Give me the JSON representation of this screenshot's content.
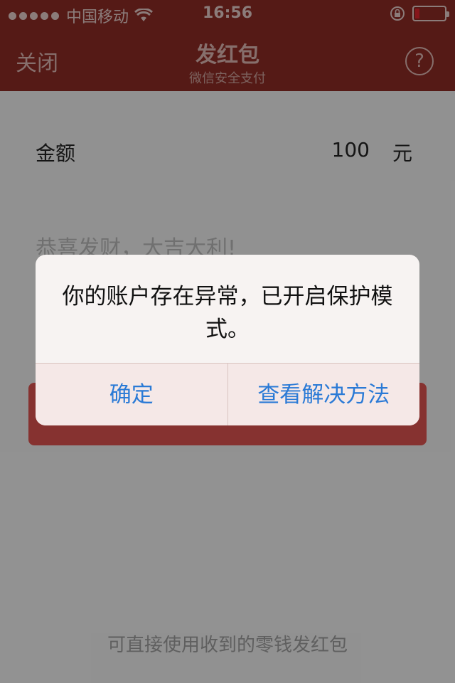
{
  "status_bar": {
    "carrier": "中国移动",
    "time": "16:56",
    "battery_level": 0.15,
    "icons": [
      "signal-dots-icon",
      "wifi-icon",
      "rotation-lock-icon",
      "battery-icon"
    ]
  },
  "nav": {
    "close_label": "关闭",
    "title": "发红包",
    "subtitle": "微信安全支付",
    "help_label": "?"
  },
  "form": {
    "amount_label": "金额",
    "amount_value": "100",
    "amount_unit": "元",
    "greeting_placeholder": "恭喜发财，大吉大利!"
  },
  "footer_note": "可直接使用收到的零钱发红包",
  "alert": {
    "message": "你的账户存在异常，已开启保护模式。",
    "confirm_label": "确定",
    "solution_label": "查看解决方法"
  },
  "colors": {
    "nav_bg": "#8a2a25",
    "button_red": "#d9524e",
    "alert_link": "#2a7ad6",
    "battery_red": "#d9242d"
  }
}
